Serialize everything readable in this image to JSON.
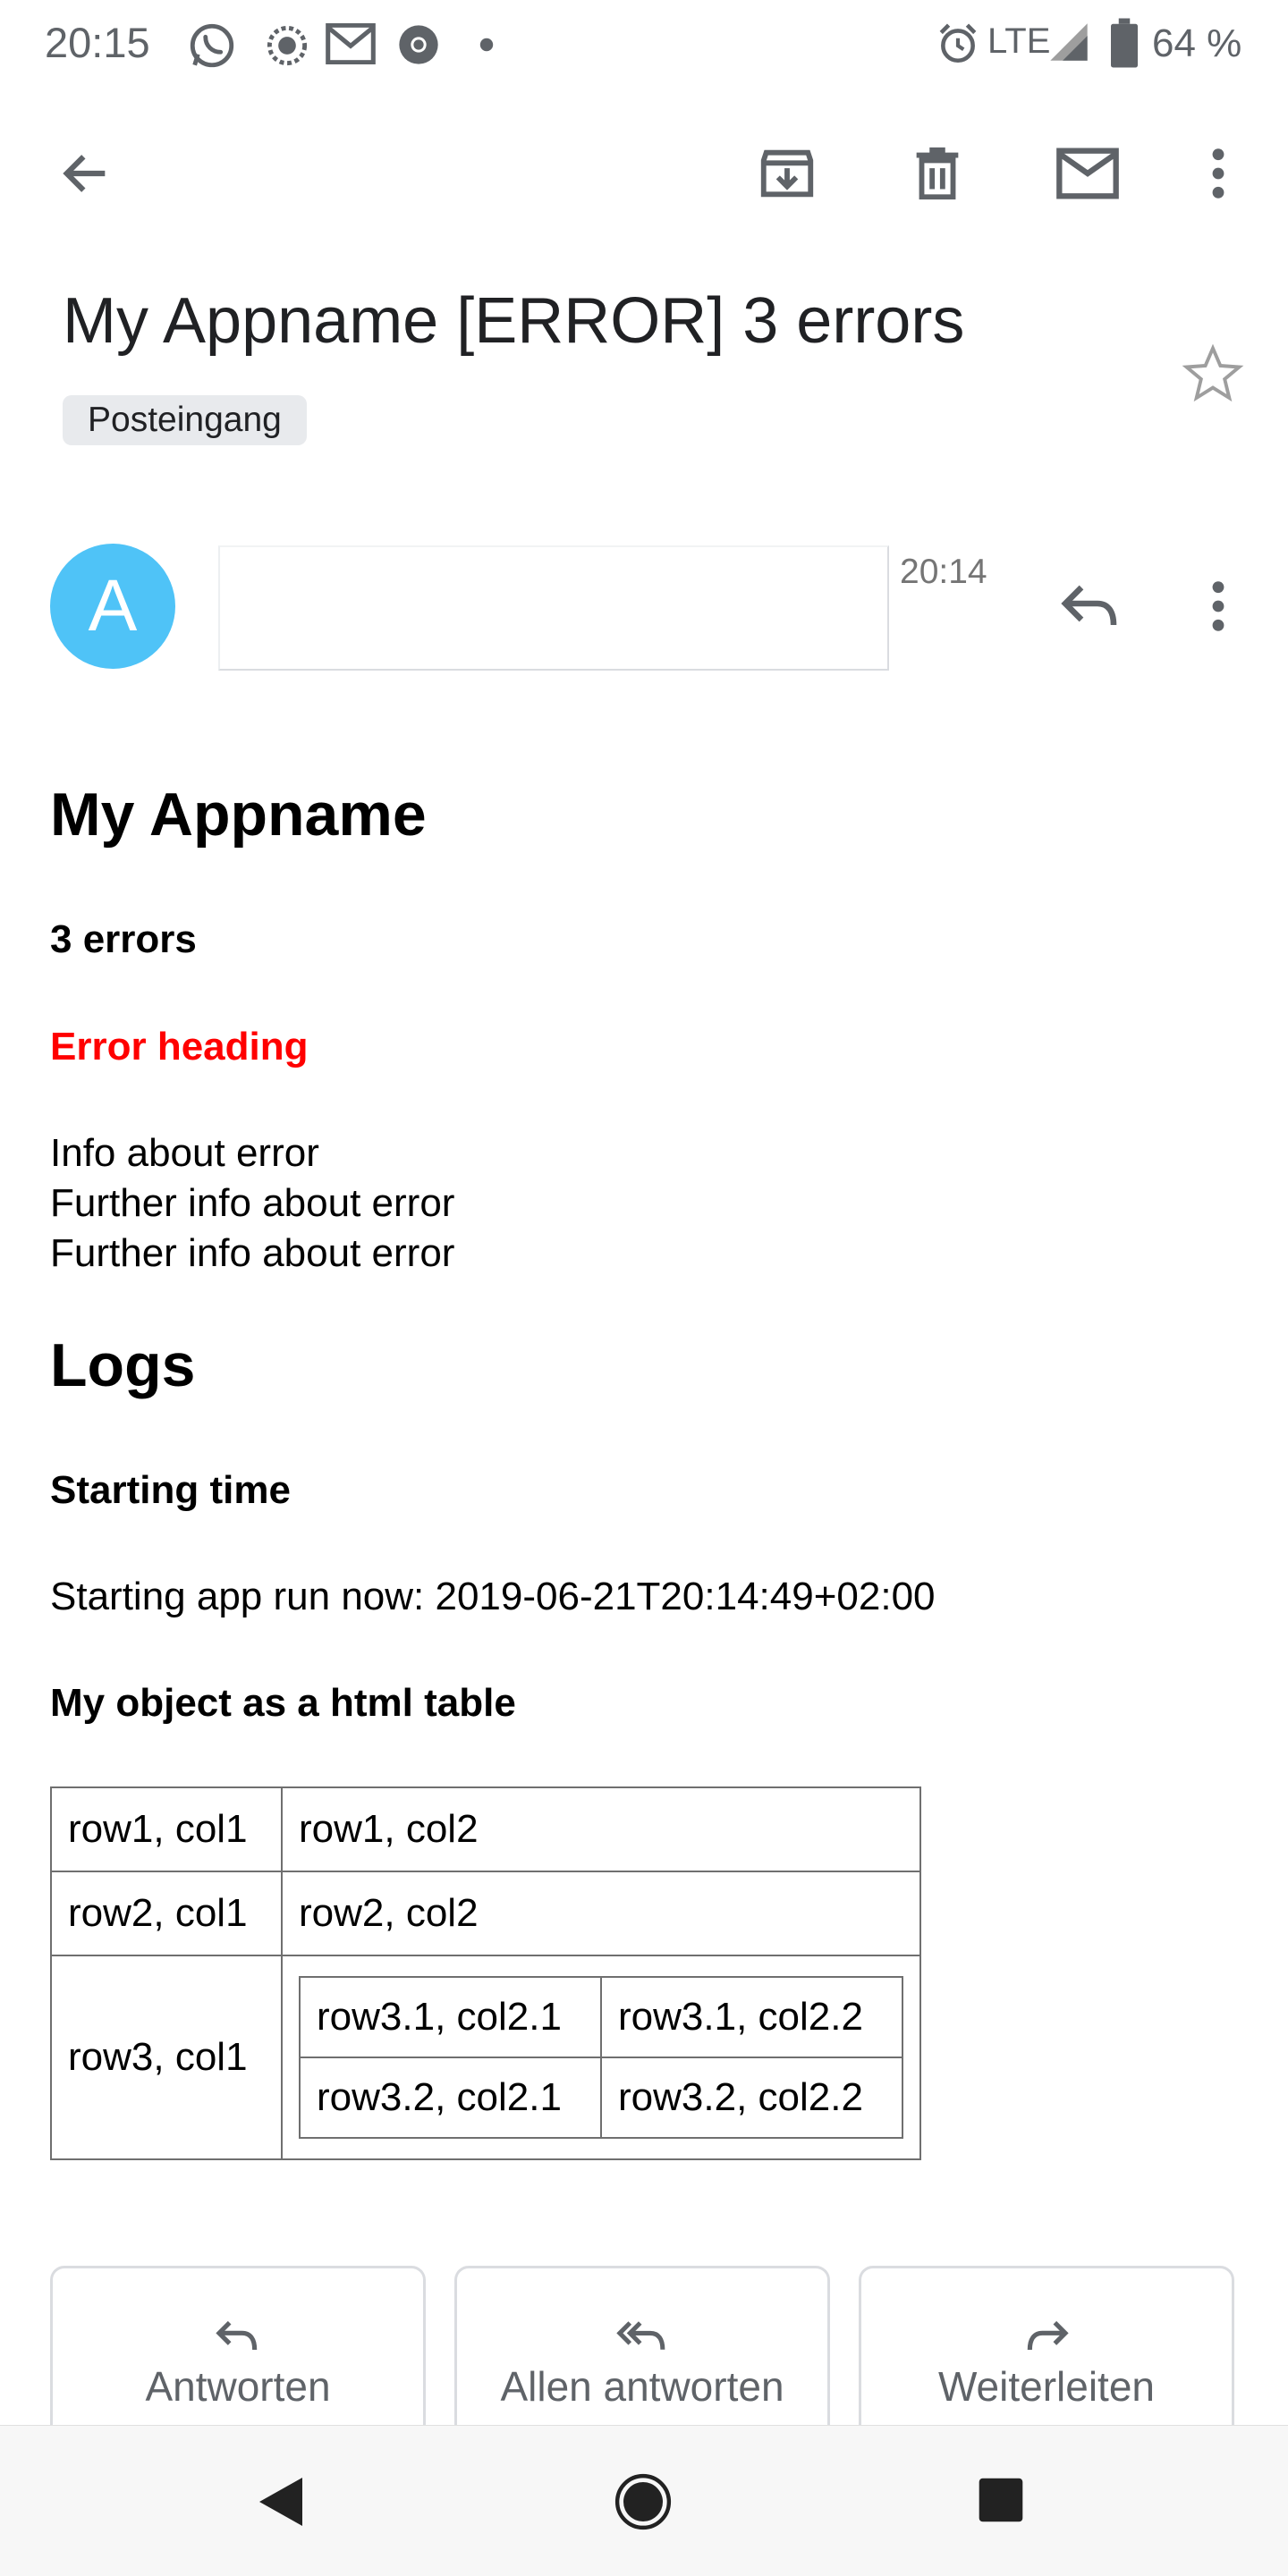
{
  "status_bar": {
    "time": "20:15",
    "network": "LTE",
    "battery": "64 %",
    "icons": [
      "whatsapp-icon",
      "lion-app-icon",
      "gmail-icon",
      "chrome-icon",
      "dot-icon",
      "alarm-icon",
      "signal-icon",
      "battery-icon"
    ]
  },
  "toolbar": {
    "icons": [
      "back-arrow-icon",
      "archive-icon",
      "delete-icon",
      "mark-unread-icon",
      "more-vert-icon"
    ]
  },
  "email": {
    "subject": "My Appname [ERROR] 3 errors",
    "label": "Posteingang",
    "sender_initial": "A",
    "time": "20:14"
  },
  "body": {
    "title": "My Appname",
    "error_count": "3 errors",
    "error_heading": "Error heading",
    "error_lines": [
      "Info about error",
      "Further info about error",
      "Further info about error"
    ],
    "logs_title": "Logs",
    "starting_time_heading": "Starting time",
    "starting_line": "Starting app run now: 2019-06-21T20:14:49+02:00",
    "table_heading": "My object as a html table",
    "table": {
      "row1": [
        "row1, col1",
        "row1, col2"
      ],
      "row2": [
        "row2, col1",
        "row2, col2"
      ],
      "row3_col1": "row3, col1",
      "nested": [
        [
          "row3.1, col2.1",
          "row3.1, col2.2"
        ],
        [
          "row3.2, col2.1",
          "row3.2, col2.2"
        ]
      ]
    }
  },
  "actions": {
    "reply": "Antworten",
    "reply_all": "Allen antworten",
    "forward": "Weiterleiten"
  },
  "colors": {
    "avatar": "#4fc3f7",
    "error": "#ff0000",
    "chip": "#e8eaed"
  }
}
